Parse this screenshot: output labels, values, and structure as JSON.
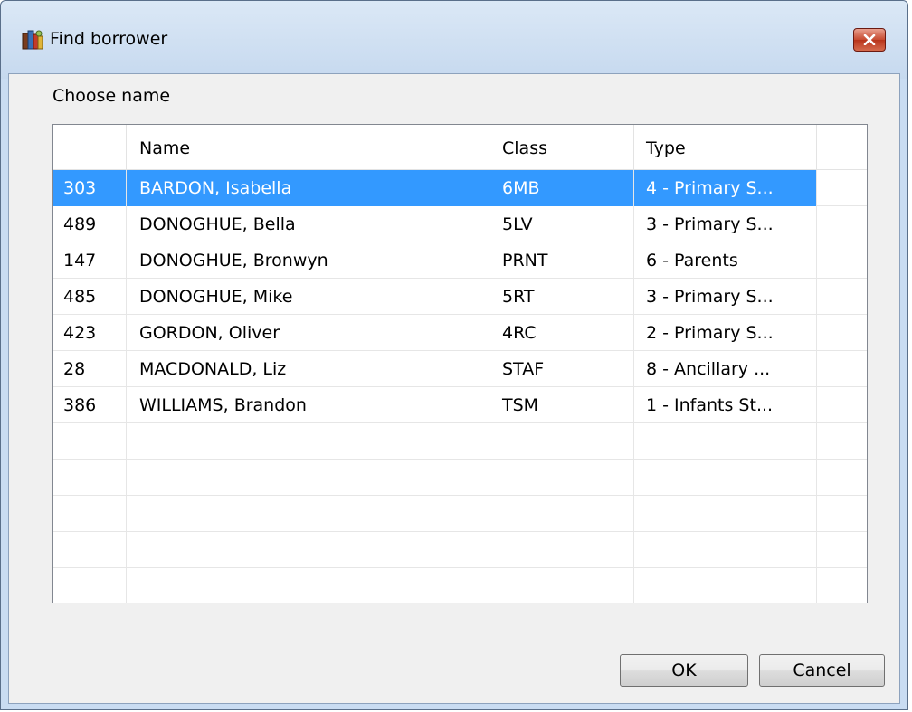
{
  "window": {
    "title": "Find borrower",
    "close_icon": "close-icon",
    "app_icon": "books-icon"
  },
  "dialog": {
    "prompt": "Choose name",
    "columns": [
      "",
      "Name",
      "Class",
      "Type"
    ],
    "rows": [
      {
        "id": "303",
        "name": "BARDON, Isabella",
        "class": "6MB",
        "type": "4 - Primary S...",
        "selected": true
      },
      {
        "id": "489",
        "name": "DONOGHUE, Bella",
        "class": "5LV",
        "type": "3 - Primary S..."
      },
      {
        "id": "147",
        "name": "DONOGHUE, Bronwyn",
        "class": "PRNT",
        "type": "6 - Parents"
      },
      {
        "id": "485",
        "name": "DONOGHUE, Mike",
        "class": "5RT",
        "type": "3 - Primary S..."
      },
      {
        "id": "423",
        "name": "GORDON, Oliver",
        "class": "4RC",
        "type": "2 - Primary S..."
      },
      {
        "id": "28",
        "name": "MACDONALD, Liz",
        "class": "STAF",
        "type": "8 - Ancillary ..."
      },
      {
        "id": "386",
        "name": "WILLIAMS, Brandon",
        "class": "TSM",
        "type": "1 - Infants St..."
      }
    ],
    "ok_label": "OK",
    "cancel_label": "Cancel"
  },
  "colors": {
    "selection": "#3399ff",
    "frame": "#c9dcf2",
    "close_button": "#c6492f"
  }
}
